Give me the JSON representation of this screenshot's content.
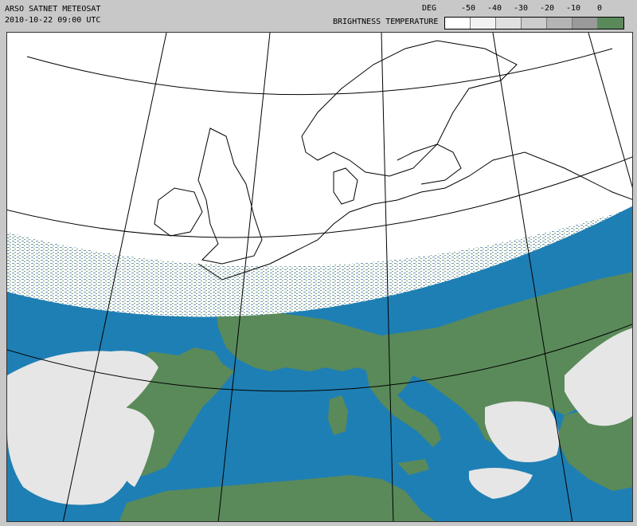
{
  "header": {
    "line1": "ARSO SATNET METEOSAT",
    "line2": "2010-10-22 09:00 UTC"
  },
  "legend": {
    "unit": "DEG",
    "title": "BRIGHTNESS TEMPERATURE",
    "ticks": [
      "-50",
      "-40",
      "-30",
      "-20",
      "-10",
      "0"
    ],
    "swatches": [
      "#ffffff",
      "#f2f2f2",
      "#e0e0e0",
      "#cccccc",
      "#b4b4b4",
      "#9a9a9a",
      "#5a8a5a"
    ]
  },
  "colors": {
    "sea": "#1e7fb4",
    "land": "#5a8a5a",
    "cloud": "#e6e6e6",
    "nodata": "#ffffff",
    "coast": "#000000"
  }
}
